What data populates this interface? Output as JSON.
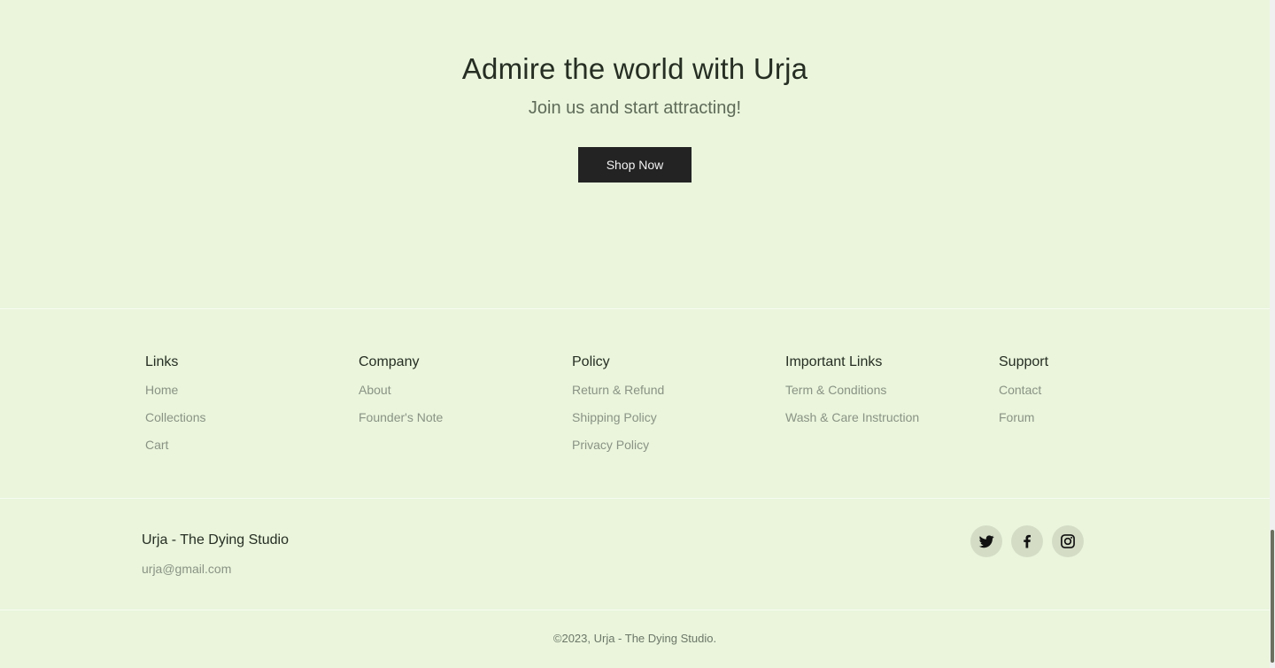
{
  "hero": {
    "title": "Admire the world with Urja",
    "subtitle": "Join us and start attracting!",
    "cta_label": "Shop Now"
  },
  "footer_columns": [
    {
      "title": "Links",
      "links": [
        "Home",
        "Collections",
        "Cart"
      ]
    },
    {
      "title": "Company",
      "links": [
        "About",
        "Founder's Note"
      ]
    },
    {
      "title": "Policy",
      "links": [
        "Return & Refund",
        "Shipping Policy",
        "Privacy Policy"
      ]
    },
    {
      "title": "Important Links",
      "links": [
        "Term & Conditions",
        "Wash & Care Instruction"
      ]
    },
    {
      "title": "Support",
      "links": [
        "Contact",
        "Forum"
      ]
    }
  ],
  "brand": {
    "name": "Urja - The Dying Studio",
    "email": "urja@gmail.com"
  },
  "social": [
    {
      "icon": "twitter-icon"
    },
    {
      "icon": "facebook-icon"
    },
    {
      "icon": "instagram-icon"
    }
  ],
  "copyright": "©2023, Urja - The Dying Studio.",
  "colors": {
    "background": "#EAF5DC",
    "button": "#232323",
    "text_muted": "#8a9384"
  }
}
